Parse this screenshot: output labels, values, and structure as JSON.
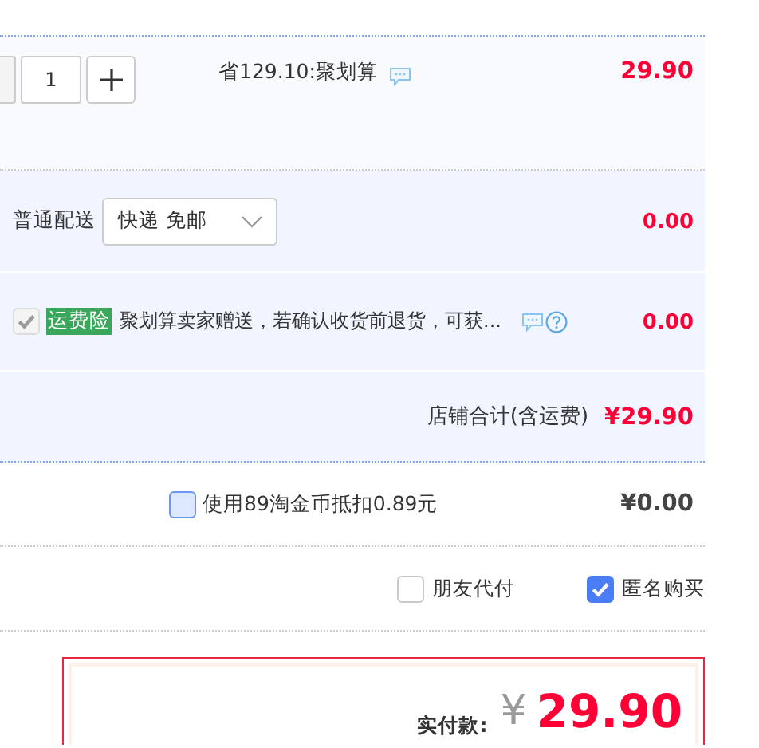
{
  "item": {
    "quantity": "1",
    "promo": "省129.10:聚划算",
    "price": "29.90"
  },
  "shipping": {
    "label": "普通配送",
    "method": "快递 免邮",
    "price": "0.00"
  },
  "insurance": {
    "checked": true,
    "disabled": true,
    "tag": "运费险",
    "text": "聚划算卖家赠送，若确认收货前退货，可获...",
    "price": "0.00"
  },
  "store_total": {
    "label": "店铺合计(含运费)",
    "amount": "¥29.90"
  },
  "coins": {
    "checked": false,
    "label": "使用89淘金币抵扣0.89元",
    "amount": "¥0.00"
  },
  "options": [
    {
      "label": "朋友代付",
      "checked": false
    },
    {
      "label": "匿名购买",
      "checked": true
    }
  ],
  "payment": {
    "label": "实付款:",
    "currency": "¥",
    "amount": "29.90"
  }
}
